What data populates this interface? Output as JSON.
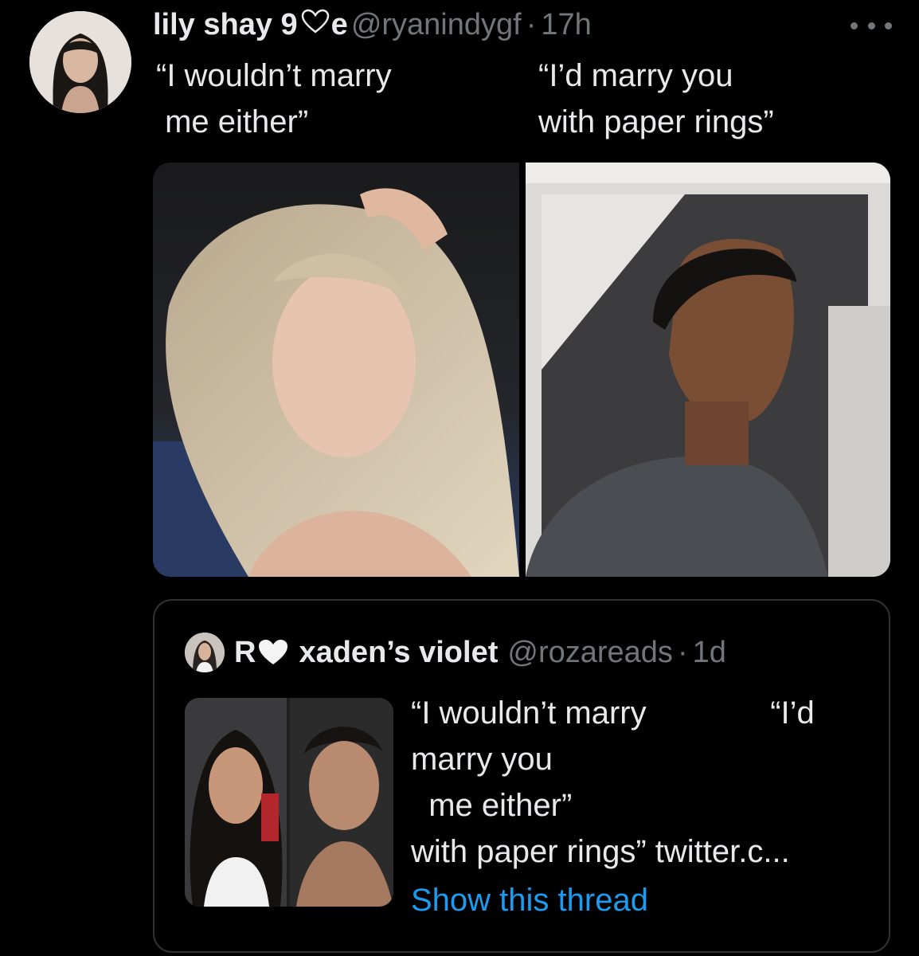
{
  "tweet": {
    "author_name": "lily shay 9",
    "author_name_suffix": "e",
    "handle": "@ryanindygf",
    "separator": "·",
    "time": "17h",
    "text_left": "“I wouldn’t marry\n me either”",
    "text_right": "“I’d marry you\nwith paper rings”"
  },
  "quote": {
    "author_prefix": "R",
    "author_name": "xaden’s violet",
    "handle": "@rozareads",
    "separator": "·",
    "time": "1d",
    "text": "“I wouldn’t marry              “I’d\nmarry you\n  me either”\nwith paper rings” twitter.c...",
    "show_thread_label": "Show this thread"
  },
  "colors": {
    "background": "#000000",
    "text_primary": "#e7e9ea",
    "text_secondary": "#71767b",
    "link": "#1d9bf0",
    "border": "#2f3336"
  },
  "icons": {
    "more": "more-horizontal-icon",
    "heart_outline": "heart-outline-icon",
    "heart_filled": "heart-filled-icon"
  }
}
